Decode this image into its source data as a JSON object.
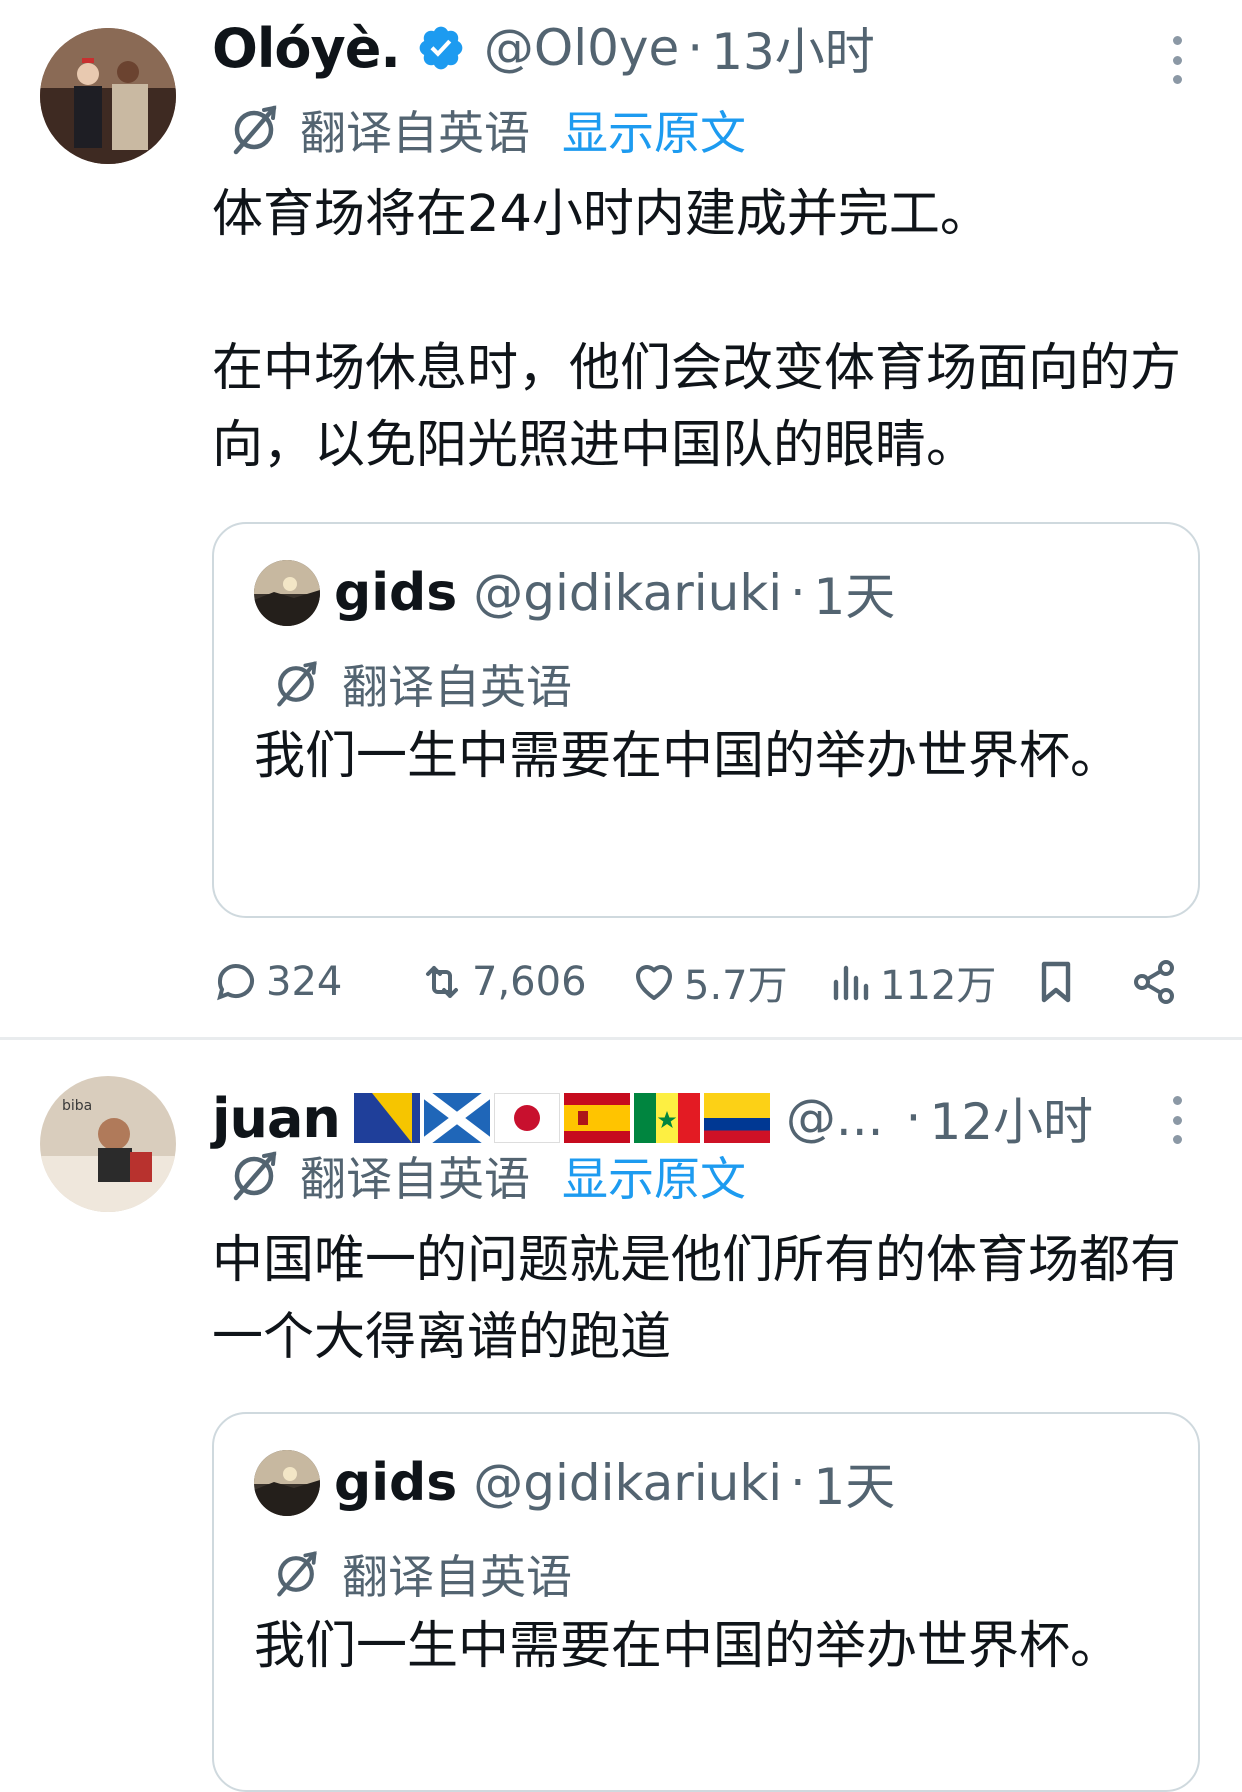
{
  "tweets": [
    {
      "name": "Olóyè.",
      "verified": true,
      "handle": "@Ol0ye",
      "time": "13小时",
      "translated_label": "翻译自英语",
      "show_original": "显示原文",
      "text_paragraphs": [
        "体育场将在24小时内建成并完工。",
        "在中场休息时，他们会改变体育场面向的方向，以免阳光照进中国队的眼睛。"
      ],
      "quote": {
        "name": "gids",
        "handle": "@gidikariuki",
        "time": "1天",
        "translated_label": "翻译自英语",
        "text": "我们一生中需要在中国的举办世界杯。"
      },
      "actions": {
        "replies": "324",
        "retweets": "7,606",
        "likes": "5.7万",
        "views": "112万"
      }
    },
    {
      "name": "juan",
      "flags": [
        "🇧🇦",
        "🏴",
        "🇯🇵",
        "🇪🇸",
        "🇸🇳",
        "🇨🇴"
      ],
      "handle": "@...",
      "time": "12小时",
      "translated_label": "翻译自英语",
      "show_original": "显示原文",
      "avatar_caption": "biba",
      "text_paragraphs": [
        "中国唯一的问题就是他们所有的体育场都有一个大得离谱的跑道"
      ],
      "quote": {
        "name": "gids",
        "handle": "@gidikariuki",
        "time": "1天",
        "translated_label": "翻译自英语",
        "text": "我们一生中需要在中国的举办世界杯。"
      }
    }
  ],
  "colors": {
    "text": "#0f1419",
    "secondary": "#536471",
    "link": "#1d9bf0",
    "border": "#cfd9de"
  },
  "icons": [
    "verified-badge-icon",
    "translate-icon",
    "more-icon",
    "reply-icon",
    "retweet-icon",
    "like-icon",
    "views-icon",
    "bookmark-icon",
    "share-icon"
  ]
}
